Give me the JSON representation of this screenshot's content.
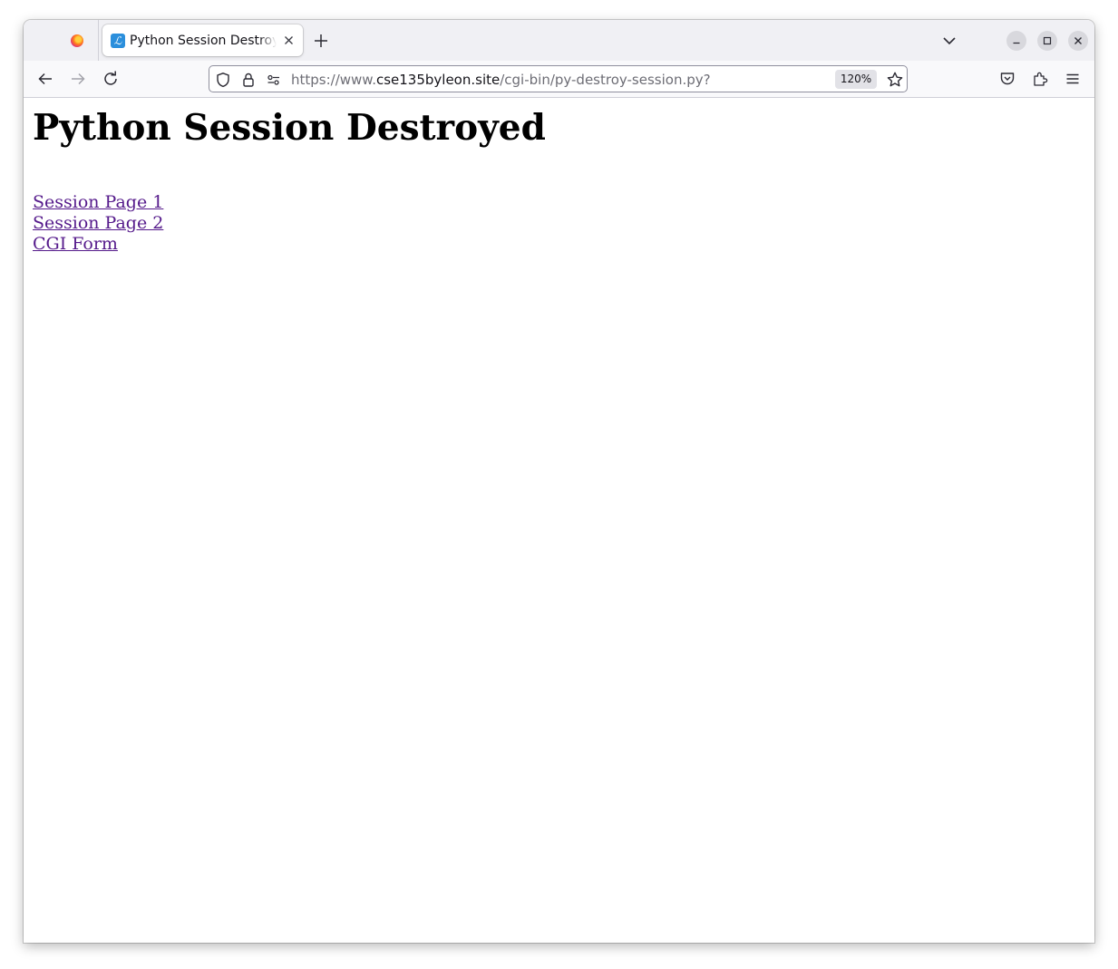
{
  "browser": {
    "tab": {
      "title": "Python Session Destroyed",
      "favicon_glyph": "ℒ"
    },
    "url": {
      "scheme_prefix": "https://www.",
      "host": "cse135byleon.site",
      "path": "/cgi-bin/py-destroy-session.py?"
    },
    "zoom": "120%"
  },
  "page": {
    "heading": "Python Session Destroyed",
    "links": [
      {
        "label": "Session Page 1"
      },
      {
        "label": "Session Page 2"
      },
      {
        "label": "CGI Form"
      }
    ]
  },
  "colors": {
    "visited_link": "#551a8b",
    "favicon_bg": "#2b8fdc"
  }
}
